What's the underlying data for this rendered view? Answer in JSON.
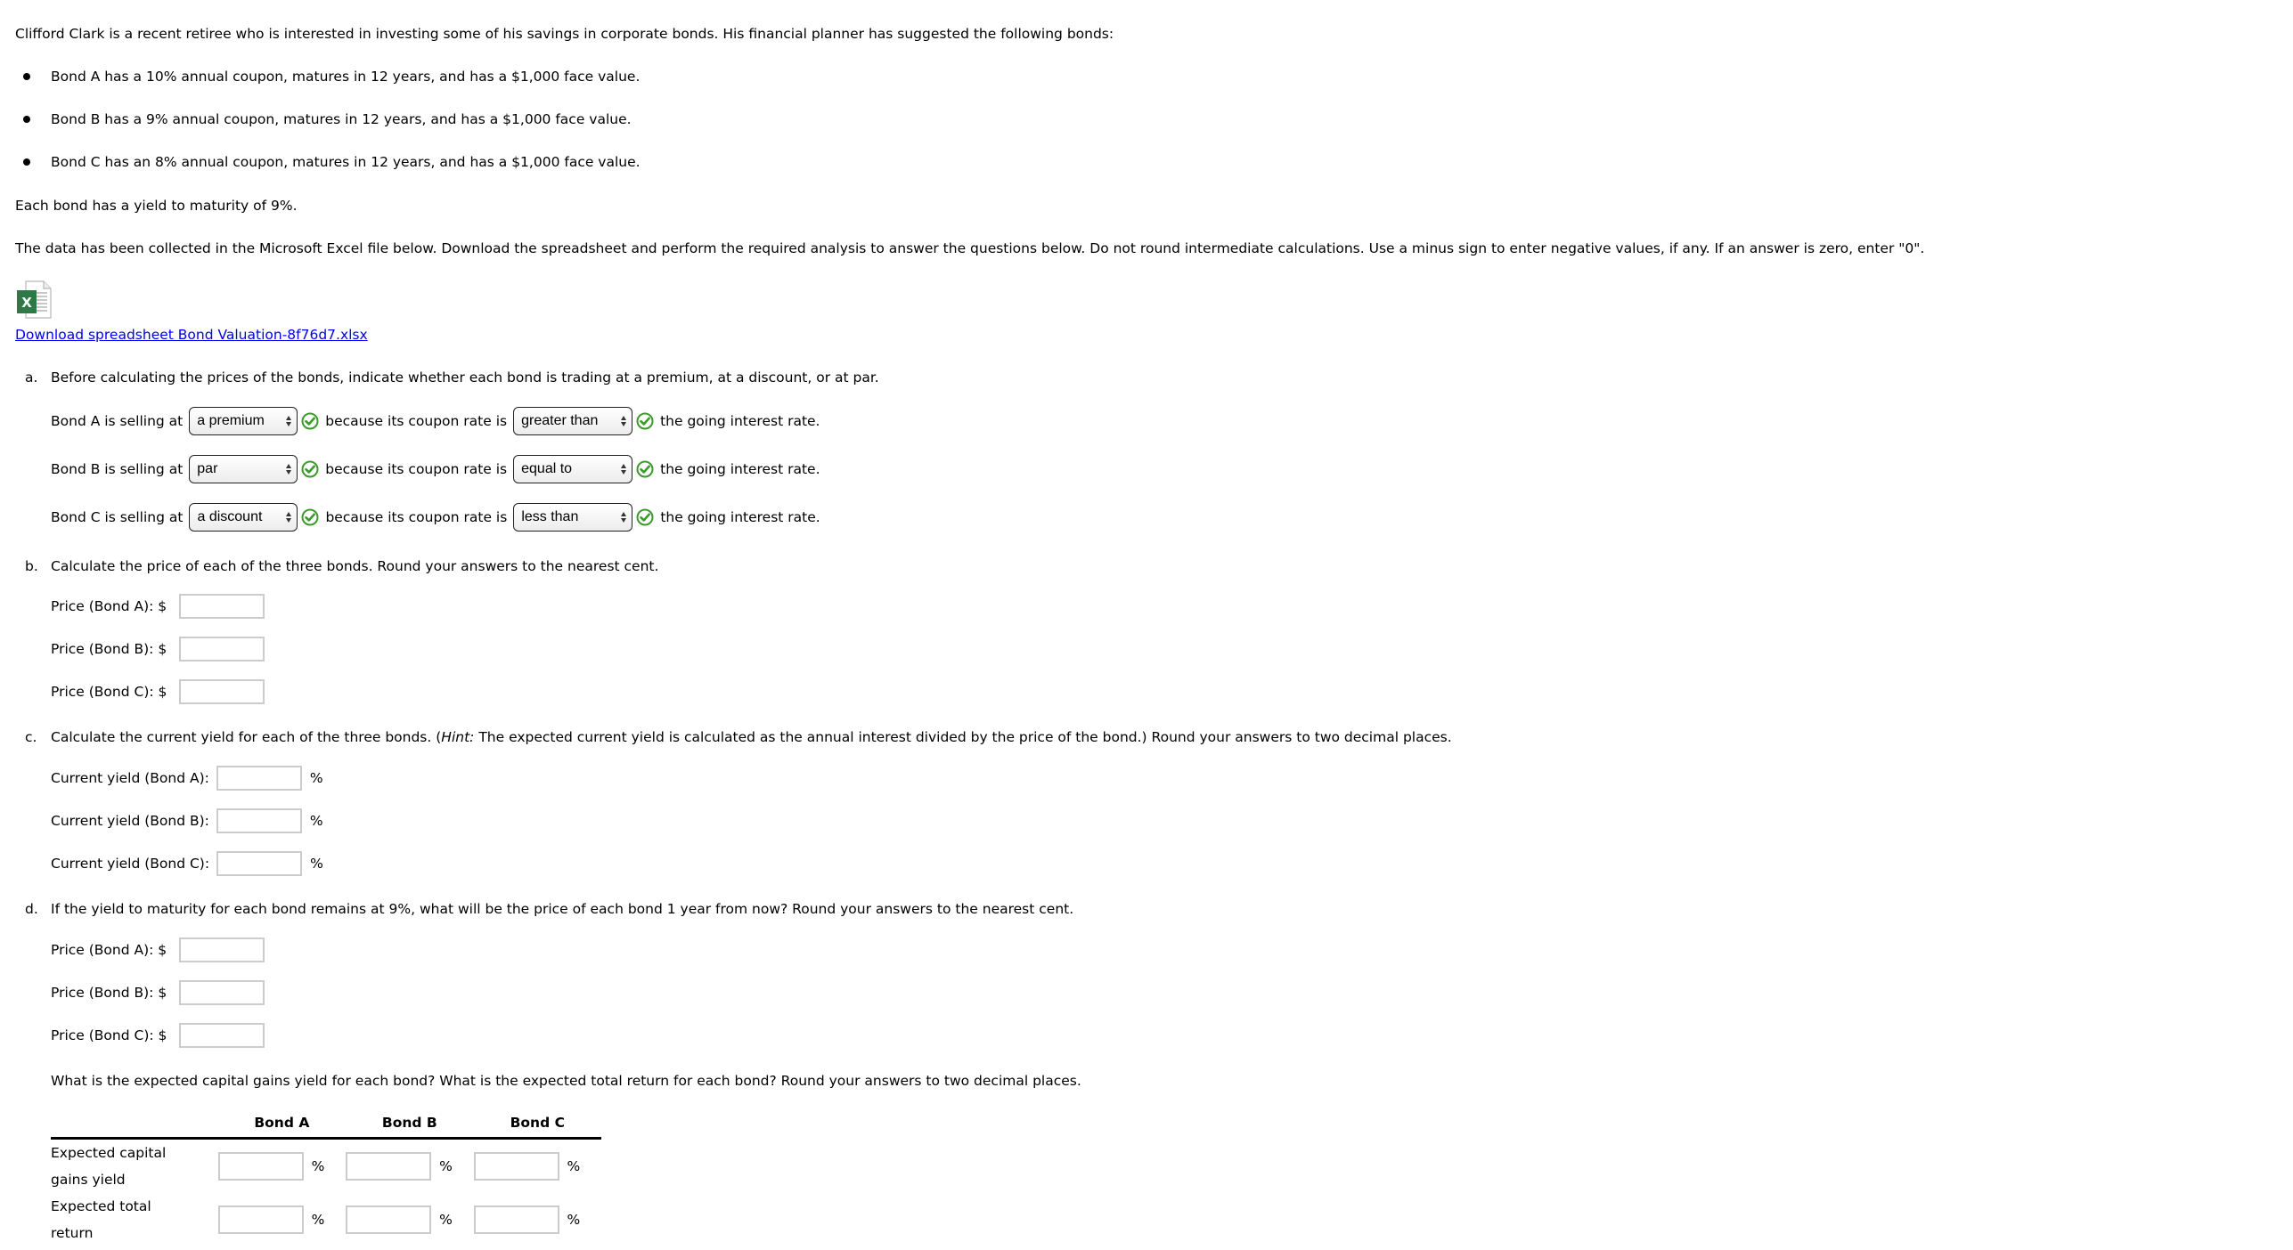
{
  "intro": "Clifford Clark is a recent retiree who is interested in investing some of his savings in corporate bonds. His financial planner has suggested the following bonds:",
  "bonds": [
    "Bond A has a 10% annual coupon, matures in 12 years, and has a $1,000 face value.",
    "Bond B has a 9% annual coupon, matures in 12 years, and has a $1,000 face value.",
    "Bond C has an 8% annual coupon, matures in 12 years, and has a $1,000 face value."
  ],
  "ytm_statement": "Each bond has a yield to maturity of 9%.",
  "instructions": "The data has been collected in the Microsoft Excel file below. Download the spreadsheet and perform the required analysis to answer the questions below. Do not round intermediate calculations. Use a minus sign to enter negative values, if any. If an answer is zero, enter \"0\".",
  "download": {
    "icon": "excel-file-icon",
    "link_text": "Download spreadsheet Bond Valuation-8f76d7.xlsx"
  },
  "part_a": {
    "letter": "a.",
    "question": "Before calculating the prices of the bonds, indicate whether each bond is trading at a premium, at a discount, or at par.",
    "rows": [
      {
        "prefix": "Bond A is selling at",
        "selling_value": "a premium",
        "middle": "because its coupon rate is",
        "rate_value": "greater than",
        "suffix": "the going interest rate."
      },
      {
        "prefix": "Bond B is selling at",
        "selling_value": "par",
        "middle": "because its coupon rate is",
        "rate_value": "equal to",
        "suffix": "the going interest rate."
      },
      {
        "prefix": "Bond C is selling at",
        "selling_value": "a discount",
        "middle": "because its coupon rate is",
        "rate_value": "less than",
        "suffix": "the going interest rate."
      }
    ],
    "status_icon": "check-circle-icon",
    "status_color": "#3a9a2a"
  },
  "part_b": {
    "letter": "b.",
    "question": "Calculate the price of each of the three bonds. Round your answers to the nearest cent.",
    "fields": [
      {
        "label": "Price (Bond A): $",
        "value": ""
      },
      {
        "label": "Price (Bond B): $",
        "value": ""
      },
      {
        "label": "Price (Bond C): $",
        "value": ""
      }
    ]
  },
  "part_c": {
    "letter": "c.",
    "question_before_hint": "Calculate the current yield for each of the three bonds. (",
    "hint_label": "Hint:",
    "question_after_hint": " The expected current yield is calculated as the annual interest divided by the price of the bond.) Round your answers to two decimal places.",
    "fields": [
      {
        "label": "Current yield (Bond A):",
        "value": "",
        "unit": "%"
      },
      {
        "label": "Current yield (Bond B):",
        "value": "",
        "unit": "%"
      },
      {
        "label": "Current yield (Bond C):",
        "value": "",
        "unit": "%"
      }
    ]
  },
  "part_d": {
    "letter": "d.",
    "question": "If the yield to maturity for each bond remains at 9%, what will be the price of each bond 1 year from now? Round your answers to the nearest cent.",
    "fields": [
      {
        "label": "Price (Bond A): $",
        "value": ""
      },
      {
        "label": "Price (Bond B): $",
        "value": ""
      },
      {
        "label": "Price (Bond C): $",
        "value": ""
      }
    ],
    "followup": "What is the expected capital gains yield for each bond? What is the expected total return for each bond? Round your answers to two decimal places.",
    "table": {
      "columns": [
        "Bond A",
        "Bond B",
        "Bond C"
      ],
      "rows": [
        {
          "label_line1": "Expected capital",
          "label_line2": "gains yield",
          "values": [
            "",
            "",
            ""
          ],
          "unit": "%"
        },
        {
          "label_line1": "Expected total",
          "label_line2": "return",
          "values": [
            "",
            "",
            ""
          ],
          "unit": "%"
        }
      ]
    }
  }
}
